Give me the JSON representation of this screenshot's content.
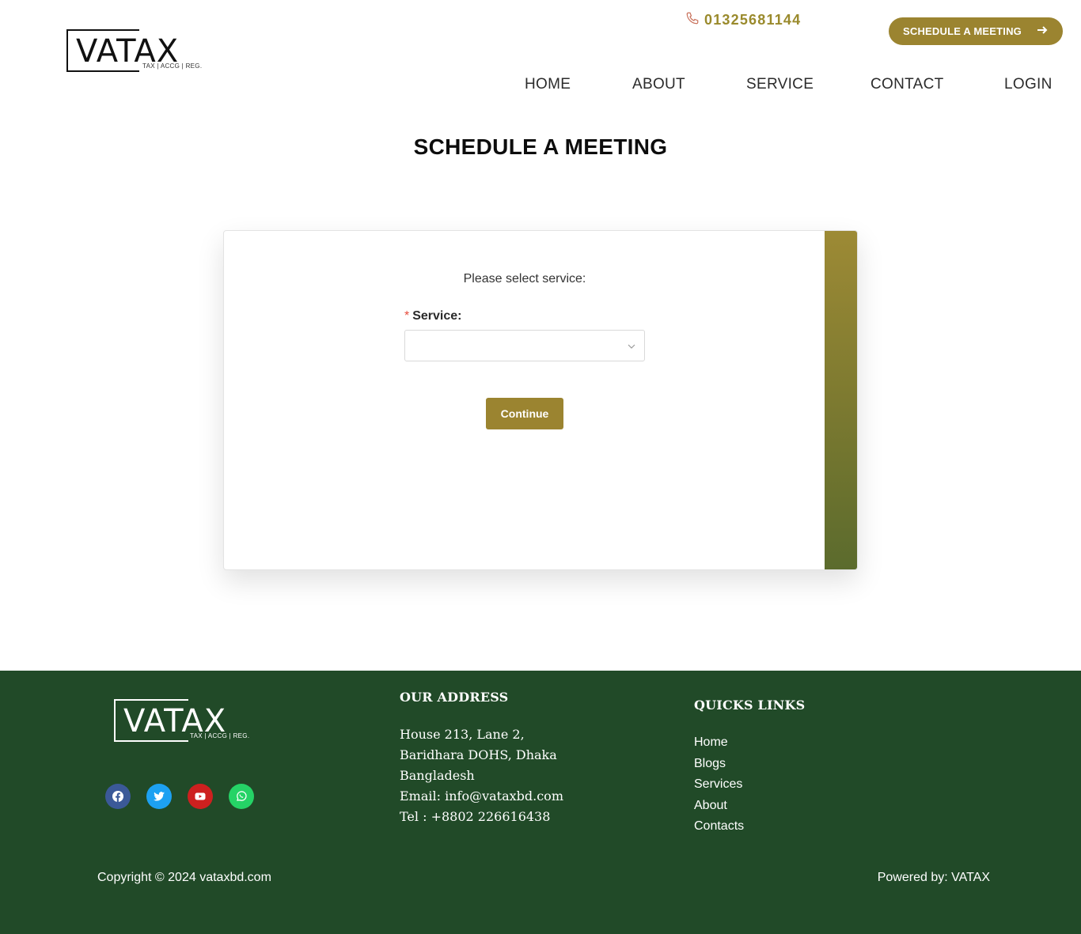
{
  "brand": {
    "logo_text": "VATAX",
    "logo_tagline": "TAX | ACCG | REG."
  },
  "header": {
    "phone": "01325681144",
    "cta_label": "SCHEDULE A MEETING",
    "nav": [
      "HOME",
      "ABOUT",
      "SERVICE",
      "CONTACT",
      "LOGIN"
    ]
  },
  "main": {
    "title": "SCHEDULE A MEETING",
    "prompt": "Please select service:",
    "required_mark": "*",
    "service_label": "Service:",
    "service_value": "",
    "continue_label": "Continue"
  },
  "footer": {
    "address_title": "OUR  ADDRESS",
    "address_lines": [
      "House 213, Lane 2,",
      "Baridhara DOHS, Dhaka",
      "Bangladesh",
      "Email:  info@vataxbd.com",
      "Tel : +8802 226616438"
    ],
    "links_title": "QUICKS LINKS",
    "links": [
      "Home",
      "Blogs",
      "Services",
      "About",
      "Contacts"
    ],
    "socials": [
      "facebook-icon",
      "twitter-icon",
      "youtube-icon",
      "whatsapp-icon"
    ],
    "copyright": "Copyright © 2024 vataxbd.com",
    "powered": "Powered by: VATAX"
  },
  "colors": {
    "accent": "#9b8430",
    "footer_bg": "#214a28",
    "phone": "#9a8a2c"
  }
}
